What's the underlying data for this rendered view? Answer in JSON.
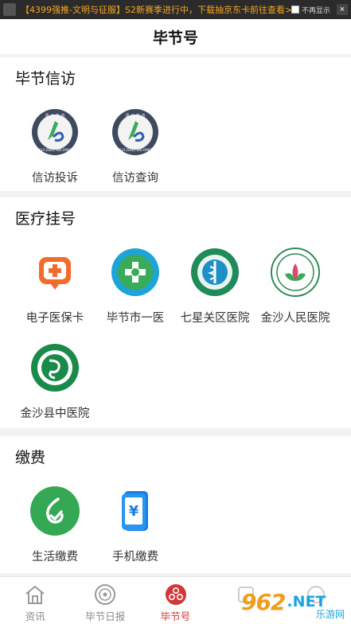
{
  "ad_bar": {
    "text": "【4399强推-文明与征服】S2新赛季进行中，下载抽京东卡前往查看>>",
    "hide_label": "不再显示",
    "close_label": "×"
  },
  "header": {
    "title": "毕节号"
  },
  "sections": {
    "xinfang": {
      "title": "毕节信访",
      "items": [
        {
          "label": "信访投诉",
          "icon": "xinfang-logo-icon"
        },
        {
          "label": "信访查询",
          "icon": "xinfang-logo-icon"
        }
      ]
    },
    "medical": {
      "title": "医疗挂号",
      "items": [
        {
          "label": "电子医保卡",
          "icon": "medical-card-icon"
        },
        {
          "label": "毕节市一医",
          "icon": "hospital-logo-icon"
        },
        {
          "label": "七星关区医院",
          "icon": "hospital-logo-icon"
        },
        {
          "label": "金沙人民医院",
          "icon": "hospital-logo-icon"
        },
        {
          "label": "金沙县中医院",
          "icon": "hospital-logo-icon"
        }
      ]
    },
    "payment": {
      "title": "缴费",
      "items": [
        {
          "label": "生活缴费",
          "icon": "life-payment-icon"
        },
        {
          "label": "手机缴费",
          "icon": "phone-payment-icon"
        }
      ]
    }
  },
  "tabbar": {
    "items": [
      {
        "label": "资讯",
        "icon": "home-icon"
      },
      {
        "label": "毕节日报",
        "icon": "newspaper-icon"
      },
      {
        "label": "毕节号",
        "icon": "bijie-hao-icon",
        "active": true
      },
      {
        "label": "",
        "icon": "tab-icon"
      },
      {
        "label": "",
        "icon": "tab-icon"
      }
    ]
  },
  "watermark": {
    "number": "962",
    "suffix": ".NET",
    "sub": "乐游网"
  },
  "colors": {
    "accent": "#d43535",
    "ad_text": "#f5a623",
    "green": "#3aab58",
    "blue": "#1a7fe0"
  }
}
